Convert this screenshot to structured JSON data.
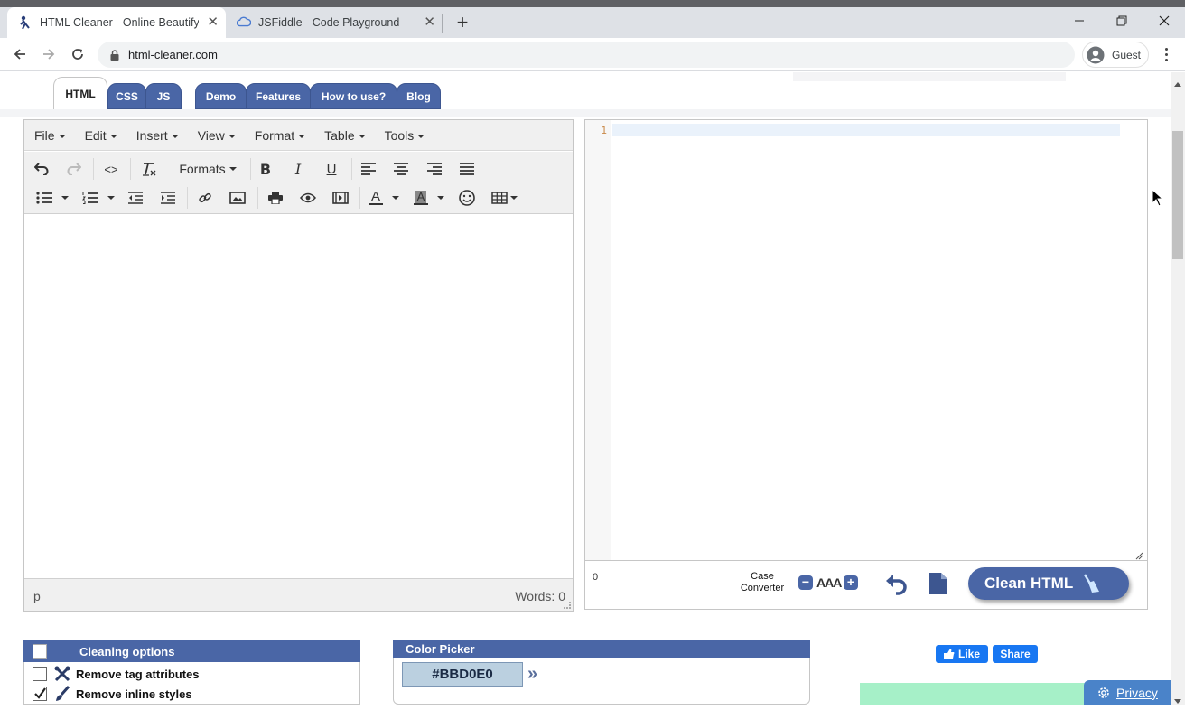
{
  "browser": {
    "tabs": [
      {
        "title": "HTML Cleaner - Online Beautifye",
        "active": true
      },
      {
        "title": "JSFiddle - Code Playground",
        "active": false
      }
    ],
    "new_tab": "+",
    "url": "html-cleaner.com",
    "profile": "Guest"
  },
  "site_tabs": {
    "editor_tabs": [
      "HTML",
      "CSS",
      "JS"
    ],
    "nav_tabs": [
      "Demo",
      "Features",
      "How to use?",
      "Blog"
    ]
  },
  "editor": {
    "menu": [
      "File",
      "Edit",
      "Insert",
      "View",
      "Format",
      "Table",
      "Tools"
    ],
    "formats_label": "Formats",
    "status_path": "p",
    "word_count": "Words: 0"
  },
  "code_panel": {
    "line_number": "1",
    "char_count": "0",
    "case_converter_label_1": "Case",
    "case_converter_label_2": "Converter",
    "case_size": "AAA",
    "clean_button": "Clean HTML"
  },
  "cleaning_options": {
    "title": "Cleaning options",
    "items": [
      {
        "label": "Remove tag attributes",
        "checked": false
      },
      {
        "label": "Remove inline styles",
        "checked": true
      }
    ]
  },
  "color_picker": {
    "title": "Color Picker",
    "value": "#BBD0E0",
    "next": "»"
  },
  "social": {
    "like": "Like",
    "share": "Share"
  },
  "privacy": "Privacy",
  "colors": {
    "accent": "#4a66a6",
    "picked": "#BBD0E0",
    "facebook": "#1877f2"
  }
}
